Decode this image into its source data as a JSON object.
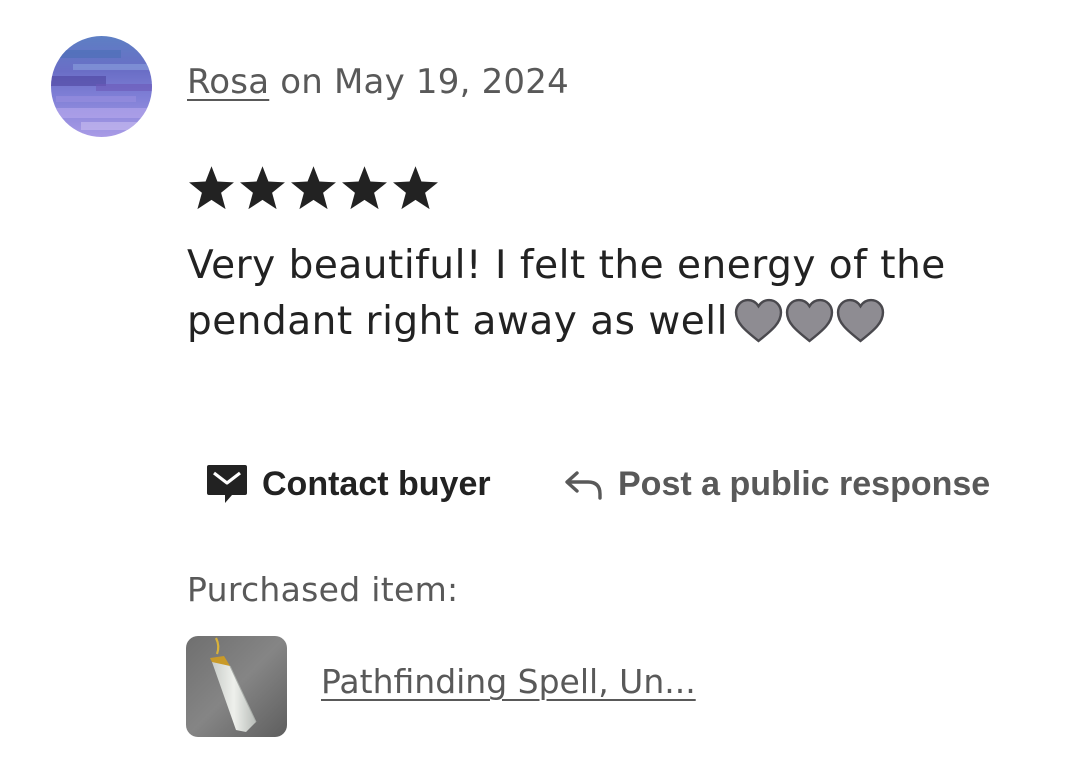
{
  "review": {
    "author": "Rosa",
    "date_text": " on May 19, 2024",
    "rating": 5,
    "rating_max": 5,
    "text": "Very beautiful! I felt the energy of the pendant right away as well",
    "emoji": [
      "grey-heart-icon",
      "grey-heart-icon",
      "grey-heart-icon"
    ]
  },
  "actions": {
    "contact_label": "Contact buyer",
    "contact_icon": "message-icon",
    "respond_label": "Post a public response",
    "respond_icon": "reply-arrow-icon"
  },
  "purchase": {
    "label": "Purchased item:",
    "item_title": "Pathfinding Spell, Un..."
  },
  "colors": {
    "text": "#222222",
    "muted": "#595959",
    "star": "#222222",
    "heart": "#8e8c92"
  }
}
